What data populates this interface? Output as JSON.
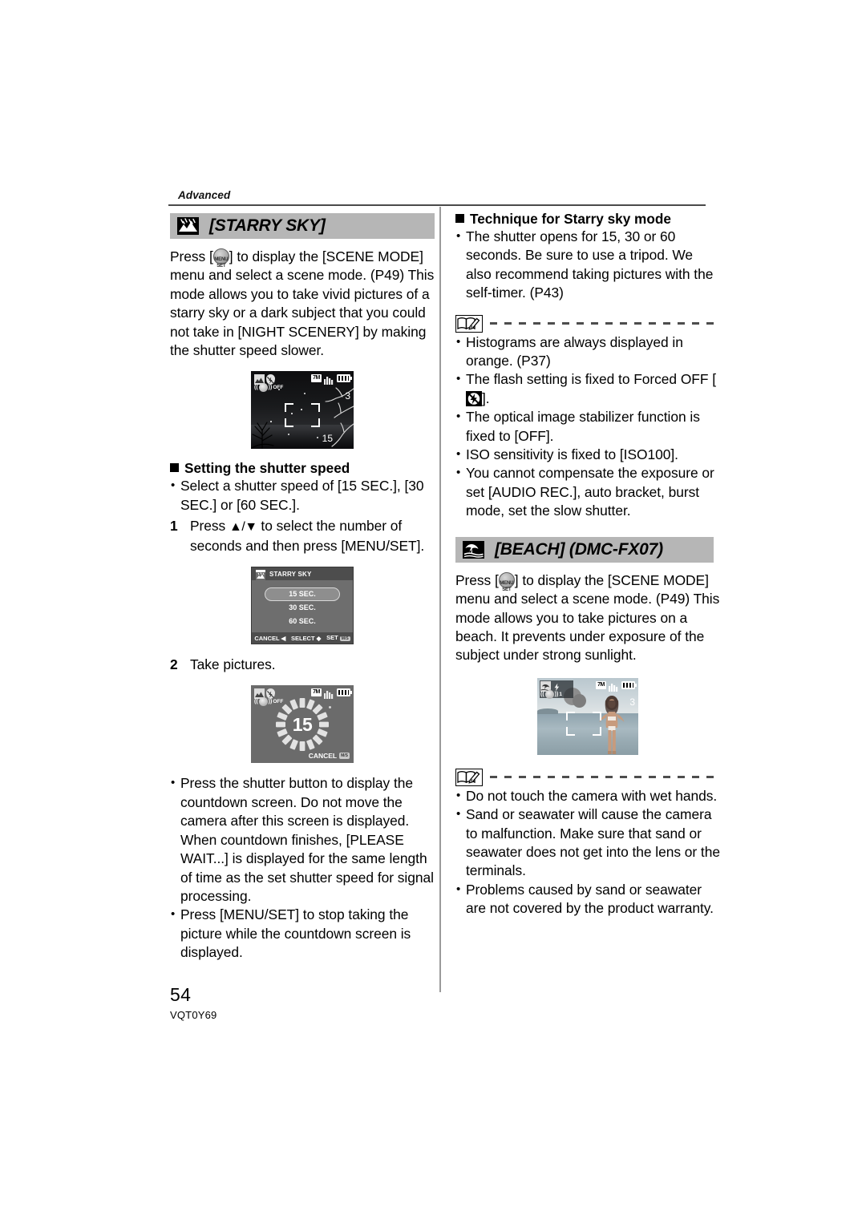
{
  "running_head": "Advanced",
  "footer": {
    "page_number": "54",
    "doc_code": "VQT0Y69"
  },
  "left_column": {
    "section": {
      "icon": "starry-sky-mode-icon",
      "title": "[STARRY SKY]"
    },
    "intro_pre": "Press [",
    "intro_icon": "menu-set-button-icon",
    "intro_post": "] to display the [SCENE MODE] menu and select a scene mode. (P49) This mode allows you to take vivid pictures of a starry sky or a dark subject that you could not take in [NIGHT SCENERY] by making the shutter speed slower.",
    "screen_night": {
      "name": "starry-sky-preview-screen",
      "pixel_badge": "7M",
      "ois_label": "OFF",
      "frames_remaining": "3",
      "shutter_seconds": "15"
    },
    "subhead_shutter": "Setting the shutter speed",
    "bullet_select": "Select a shutter speed of [15 SEC.], [30 SEC.] or [60 SEC.].",
    "step1_num": "1",
    "step1_text_a": "Press ",
    "step1_arrows": "▲/▼",
    "step1_text_b": " to select the number of seconds and then press [MENU/SET].",
    "screen_menu": {
      "name": "starry-sky-shutter-menu-screen",
      "title": "STARRY SKY",
      "options": [
        "15 SEC.",
        "30 SEC.",
        "60 SEC."
      ],
      "selected": "15 SEC.",
      "foot_cancel": "CANCEL",
      "foot_select": "SELECT",
      "foot_set": "SET"
    },
    "step2_num": "2",
    "step2_text": "Take pictures.",
    "screen_countdown": {
      "name": "starry-sky-countdown-screen",
      "pixel_badge": "7M",
      "ois_label": "OFF",
      "countdown_value": "15",
      "foot_cancel": "CANCEL"
    },
    "notes": [
      "Press the shutter button to display the countdown screen. Do not move the camera after this screen is displayed. When countdown finishes, [PLEASE WAIT...] is displayed for the same length of time as the set shutter speed for signal processing.",
      "Press [MENU/SET] to stop taking the picture while the countdown screen is displayed."
    ]
  },
  "right_column": {
    "subhead_technique": "Technique for Starry sky mode",
    "technique_bullet": "The shutter opens for 15, 30 or 60 seconds. Be sure to use a tripod. We also recommend taking pictures with the self-timer. (P43)",
    "note_icon_1": "note-book-pencil-icon",
    "notes_1": [
      {
        "text_a": "Histograms are always displayed in orange. (P37)"
      },
      {
        "text_a": "The flash setting is fixed to Forced OFF [",
        "icon": "flash-forced-off-icon",
        "text_b": "]."
      },
      {
        "text_a": "The optical image stabilizer function is fixed to [OFF]."
      },
      {
        "text_a": "ISO sensitivity is fixed to [ISO100]."
      },
      {
        "text_a": "You cannot compensate the exposure or set [AUDIO REC.], auto bracket, burst mode, set the slow shutter."
      }
    ],
    "section": {
      "icon": "beach-mode-icon",
      "title_bracket": "[BEACH]",
      "title_model": " (DMC-FX07)"
    },
    "beach_intro_pre": "Press [",
    "beach_intro_icon": "menu-set-button-icon",
    "beach_intro_post": "] to display the [SCENE MODE] menu and select a scene mode. (P49) This mode allows you to take pictures on a beach. It prevents under exposure of the subject under strong sunlight.",
    "screen_beach": {
      "name": "beach-preview-screen",
      "pixel_badge": "7M",
      "ois_label": "1",
      "frames_remaining": "3"
    },
    "note_icon_2": "note-book-pencil-icon",
    "notes_2": [
      "Do not touch the camera with wet hands.",
      "Sand or seawater will cause the camera to malfunction. Make sure that sand or seawater does not get into the lens or the terminals.",
      "Problems caused by sand or seawater are not covered by the product warranty."
    ]
  }
}
